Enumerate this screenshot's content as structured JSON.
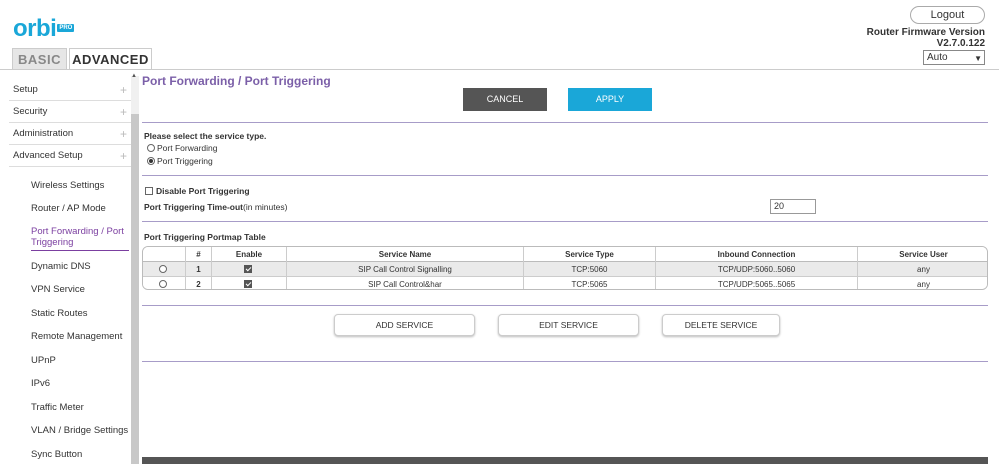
{
  "header": {
    "logo_text": "orbi",
    "logo_badge": "PRO",
    "tab_basic": "BASIC",
    "tab_advanced": "ADVANCED",
    "logout_label": "Logout",
    "firmware_label": "Router Firmware Version",
    "firmware_version": "V2.7.0.122",
    "language_select": "Auto"
  },
  "sidebar": {
    "sections": [
      {
        "label": "Setup"
      },
      {
        "label": "Security"
      },
      {
        "label": "Administration"
      },
      {
        "label": "Advanced Setup"
      }
    ],
    "subitems": [
      {
        "label": "Wireless Settings"
      },
      {
        "label": "Router / AP Mode"
      },
      {
        "label": "Port Forwarding / Port Triggering"
      },
      {
        "label": "Dynamic DNS"
      },
      {
        "label": "VPN Service"
      },
      {
        "label": "Static Routes"
      },
      {
        "label": "Remote Management"
      },
      {
        "label": "UPnP"
      },
      {
        "label": "IPv6"
      },
      {
        "label": "Traffic Meter"
      },
      {
        "label": "VLAN / Bridge Settings"
      },
      {
        "label": "Sync Button"
      }
    ]
  },
  "main": {
    "title": "Port Forwarding / Port Triggering",
    "cancel_label": "CANCEL",
    "apply_label": "APPLY",
    "service_type_prompt": "Please select the service type.",
    "radio_forwarding": "Port Forwarding",
    "radio_triggering": "Port Triggering",
    "disable_label": "Disable Port Triggering",
    "timeout_label": "Port Triggering Time-out",
    "timeout_unit": "(in minutes)",
    "timeout_value": "20",
    "table_title": "Port Triggering Portmap Table",
    "columns": [
      "#",
      "Enable",
      "Service Name",
      "Service Type",
      "Inbound Connection",
      "Service User"
    ],
    "rows": [
      {
        "num": "1",
        "name": "SIP Call Control Signalling",
        "type": "TCP:5060",
        "inbound": "TCP/UDP:5060..5060",
        "user": "any"
      },
      {
        "num": "2",
        "name": "SIP Call Control&har",
        "type": "TCP:5065",
        "inbound": "TCP/UDP:5065..5065",
        "user": "any"
      }
    ],
    "add_label": "ADD SERVICE",
    "edit_label": "EDIT SERVICE",
    "delete_label": "DELETE SERVICE"
  },
  "colors": {
    "accent": "#1aa7d8",
    "title": "#7b5fa8",
    "active_nav": "#7b3fa0"
  }
}
